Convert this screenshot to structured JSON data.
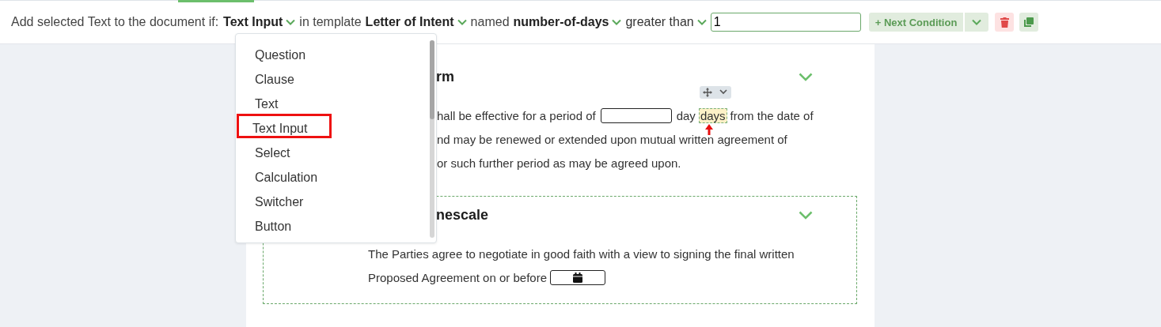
{
  "condition_bar": {
    "prefix": "Add selected Text to the document if:",
    "parts": [
      {
        "kind": "field_select",
        "value": "Text Input"
      },
      {
        "kind": "text",
        "value": "in template"
      },
      {
        "kind": "field_select",
        "value": "Letter of Intent"
      },
      {
        "kind": "text",
        "value": "named"
      },
      {
        "kind": "field_select",
        "value": "number-of-days"
      },
      {
        "kind": "operator_select",
        "value": "greater than"
      }
    ],
    "value_field": {
      "value": "1"
    },
    "next_condition_button": "+ Next Condition"
  },
  "type_menu": {
    "items": [
      {
        "label": "Question",
        "selected": false
      },
      {
        "label": "Clause",
        "selected": false
      },
      {
        "label": "Text",
        "selected": false
      },
      {
        "label": "Text Input",
        "selected": true
      },
      {
        "label": "Select",
        "selected": false
      },
      {
        "label": "Calculation",
        "selected": false
      },
      {
        "label": "Switcher",
        "selected": false
      },
      {
        "label": "Button",
        "selected": false
      }
    ]
  },
  "document": {
    "sections": [
      {
        "heading": "rm",
        "selected": false,
        "lines": [
          [
            {
              "kind": "text",
              "value": "hall be effective for a period of"
            },
            {
              "kind": "blank"
            },
            {
              "kind": "text",
              "value": "day"
            },
            {
              "kind": "variable",
              "value": "days"
            },
            {
              "kind": "text",
              "value": "from the date of"
            }
          ],
          [
            {
              "kind": "text",
              "value": "nd may be renewed or extended upon mutual written agreement of"
            }
          ],
          [
            {
              "kind": "text",
              "value": "or such further period as may be agreed upon."
            }
          ]
        ]
      },
      {
        "heading": "nescale",
        "selected": true,
        "lines": [
          [
            {
              "kind": "text",
              "value": "The Parties agree to negotiate in good faith with a view to signing the final written"
            }
          ],
          [
            {
              "kind": "text",
              "value": "Proposed Agreement on or before"
            },
            {
              "kind": "date"
            }
          ]
        ]
      }
    ]
  }
}
